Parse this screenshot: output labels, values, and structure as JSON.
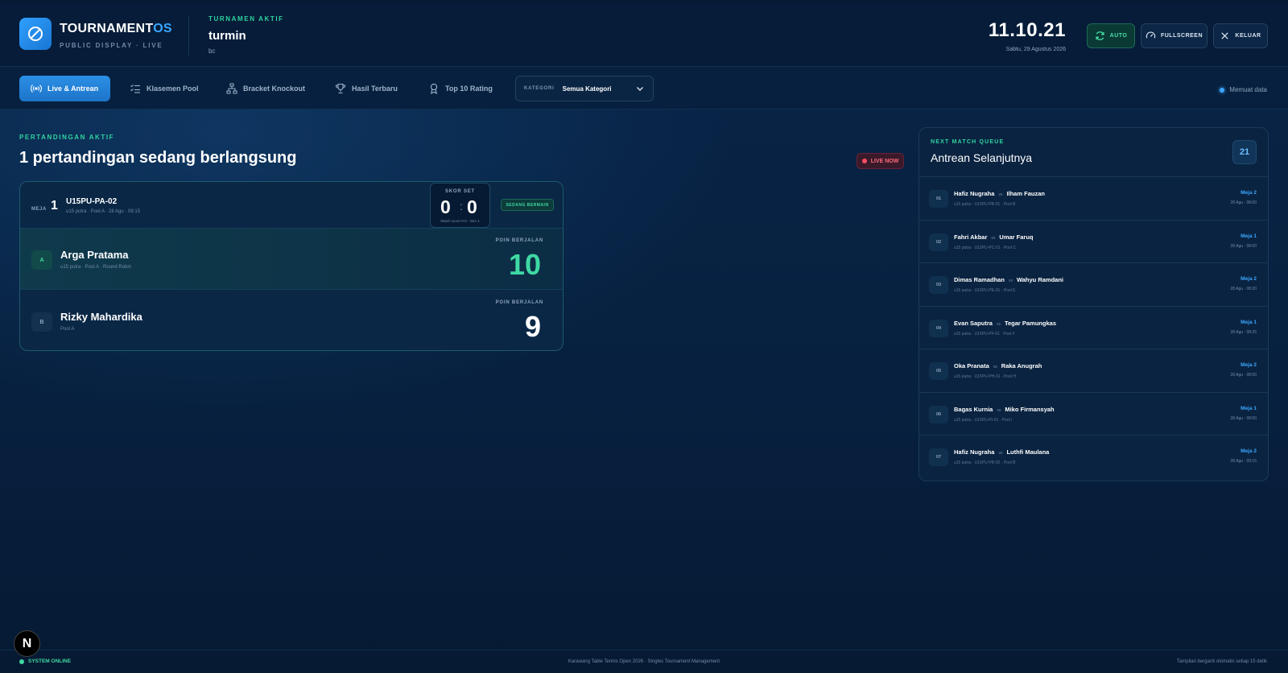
{
  "brand": {
    "name_main": "TOURNAMENT",
    "name_accent": "OS",
    "subtitle": "PUBLIC DISPLAY · LIVE"
  },
  "tournament": {
    "label": "TURNAMEN AKTIF",
    "name": "turmin",
    "sub": "bc"
  },
  "clock": {
    "time": "11.10.21",
    "date": "Sabtu, 29 Agustus 2026"
  },
  "header_buttons": {
    "auto": "AUTO",
    "fullscreen": "FULLSCREEN",
    "keluar": "KELUAR"
  },
  "nav": {
    "tabs": [
      "Live & Antrean",
      "Klasemen Pool",
      "Bracket Knockout",
      "Hasil Terbaru",
      "Top 10 Rating"
    ],
    "category_label": "KATEGORI",
    "category_value": "Semua Kategori",
    "loading": "Memuat data"
  },
  "active": {
    "label": "PERTANDINGAN AKTIF",
    "title": "1 pertandingan sedang berlangsung",
    "live_badge": "LIVE NOW"
  },
  "match": {
    "meja_label": "MEJA",
    "meja": "1",
    "code": "U15PU-PA-02",
    "meta": "u15 putra · Pool A · 28 Agu · 09:15",
    "score_label": "SKOR SET",
    "score_a": "0",
    "score_sep": ":",
    "score_b": "0",
    "score_sub": "Match score 0-0 · Gim 1",
    "status": "SEDANG BERMAIN",
    "points_label": "POIN BERJALAN",
    "player_a": {
      "badge": "A",
      "name": "Arga Pratama",
      "sub": "u15 putra · Pool A · Round Robin",
      "points": "10"
    },
    "player_b": {
      "badge": "B",
      "name": "Rizky Mahardika",
      "sub": "Pool A",
      "points": "9"
    }
  },
  "queue": {
    "label": "NEXT MATCH QUEUE",
    "title": "Antrean Selanjutnya",
    "count": "21",
    "vs": "vs",
    "items": [
      {
        "no": "01",
        "p1": "Hafiz Nugraha",
        "p2": "Ilham Fauzan",
        "meta": "u15 putra · U15PU-PB-01 · Pool B",
        "meja": "Meja 2",
        "time": "28 Agu · 08:00"
      },
      {
        "no": "02",
        "p1": "Fahri Akbar",
        "p2": "Umar Faruq",
        "meta": "u15 putra · U15PU-PC-01 · Pool C",
        "meja": "Meja 1",
        "time": "28 Agu · 08:00"
      },
      {
        "no": "03",
        "p1": "Dimas Ramadhan",
        "p2": "Wahyu Ramdani",
        "meta": "u15 putra · U15PU-PE-01 · Pool E",
        "meja": "Meja 2",
        "time": "28 Agu · 08:20"
      },
      {
        "no": "04",
        "p1": "Evan Saputra",
        "p2": "Tegar Pamungkas",
        "meta": "u15 putra · U15PU-PF-01 · Pool F",
        "meja": "Meja 1",
        "time": "28 Agu · 08:25"
      },
      {
        "no": "05",
        "p1": "Oka Pranata",
        "p2": "Raka Anugrah",
        "meta": "u15 putra · U15PU-PH-01 · Pool H",
        "meja": "Meja 2",
        "time": "28 Agu · 08:50"
      },
      {
        "no": "06",
        "p1": "Bagas Kurnia",
        "p2": "Miko Firmansyah",
        "meta": "u15 putra · U15PU-PI-01 · Pool I",
        "meja": "Meja 1",
        "time": "28 Agu · 08:50"
      },
      {
        "no": "07",
        "p1": "Hafiz Nugraha",
        "p2": "Luthfi Maulana",
        "meta": "u15 putra · U15PU-PB-02 · Pool B",
        "meja": "Meja 2",
        "time": "28 Agu · 09:15"
      }
    ]
  },
  "footer": {
    "status": "SYSTEM ONLINE",
    "middle": "Karawang Table Tennis Open 2026 · Singles Tournament Management",
    "right": "Tampilan berganti otomatis setiap 15 detik"
  },
  "dev_badge": "N",
  "colors": {
    "accent_blue": "#2b8fe6",
    "accent_green": "#3fd9a3",
    "live_red": "#ff4d63",
    "background": "#061a33"
  }
}
